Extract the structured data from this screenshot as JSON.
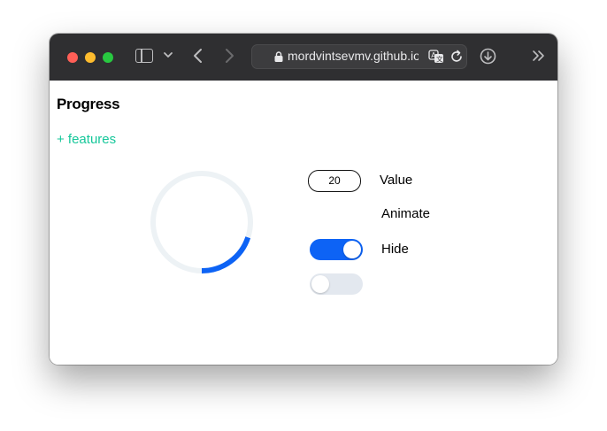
{
  "browser": {
    "url": "mordvintsevmv.github.io",
    "icons": {
      "sidebar": "sidebar-icon",
      "tab_overview": "chevron-down-icon",
      "back": "chevron-left-icon",
      "forward": "chevron-right-icon",
      "lock": "lock-icon",
      "translate": "translate-icon",
      "reload": "reload-icon",
      "download": "download-icon",
      "more": "double-chevron-right-icon"
    },
    "colors": {
      "toolbar": "#2f2f31",
      "close": "#ff5f57",
      "minimize": "#febc2e",
      "maximize": "#28c840"
    }
  },
  "page": {
    "title": "Progress",
    "features_link": "+ features",
    "progress": {
      "value": 20,
      "unit": "percent"
    },
    "controls": {
      "value_input": "20",
      "value_label": "Value",
      "animate_label": "Animate",
      "animate_on": true,
      "hide_label": "Hide",
      "hide_on": false
    },
    "colors": {
      "accent": "#0d63f5",
      "link": "#16c79a",
      "track": "#edf2f5",
      "toggle_off": "#e3e8ef"
    }
  }
}
